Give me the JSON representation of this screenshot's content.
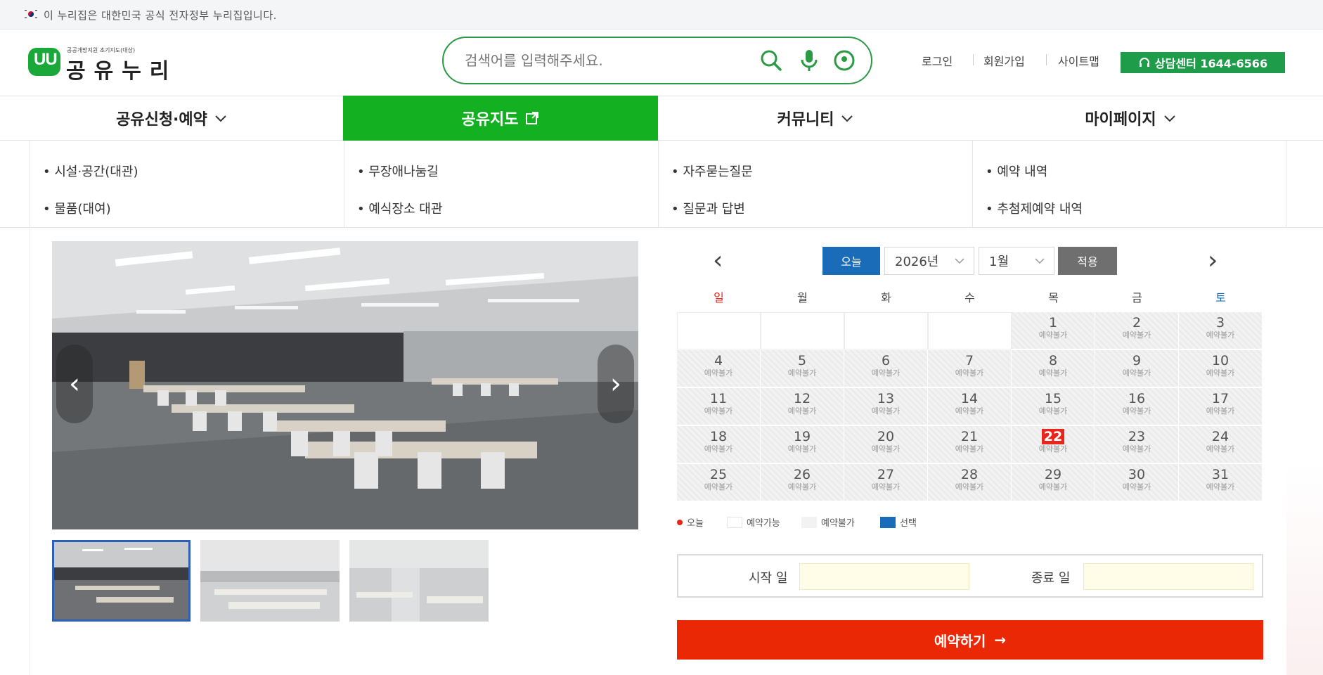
{
  "gov_banner": {
    "text": "이 누리집은 대한민국 공식 전자정부 누리집입니다."
  },
  "logo": {
    "subtitle": "공공개방지원 초기지도(대상)",
    "name": "공유누리"
  },
  "search": {
    "placeholder": "검색어를 입력해주세요.",
    "icons": [
      "search-icon",
      "microphone-icon",
      "location-icon"
    ]
  },
  "utility": {
    "login": "로그인",
    "signup": "회원가입",
    "sitemap": "사이트맵",
    "call_center": "상담센터 1644-6566"
  },
  "nav": {
    "items": [
      {
        "label": "공유신청·예약",
        "icon": "chevron-down-icon",
        "active": false
      },
      {
        "label": "공유지도",
        "icon": "external-link-icon",
        "active": true
      },
      {
        "label": "커뮤니티",
        "icon": "chevron-down-icon",
        "active": false
      },
      {
        "label": "마이페이지",
        "icon": "chevron-down-icon",
        "active": false
      }
    ]
  },
  "submenu": {
    "columns": [
      [
        "• 시설·공간(대관)",
        "• 물품(대여)"
      ],
      [
        "• 무장애나눔길",
        "• 예식장소 대관"
      ],
      [
        "• 자주묻는질문",
        "• 질문과 답변"
      ],
      [
        "• 예약 내역",
        "• 추첨제예약 내역"
      ]
    ]
  },
  "gallery": {
    "main_image": "conference-room-photo",
    "prev_icon": "chevron-left-icon",
    "next_icon": "chevron-right-icon",
    "thumbnails": [
      {
        "name": "thumbnail-1",
        "selected": true
      },
      {
        "name": "thumbnail-2",
        "selected": false
      },
      {
        "name": "thumbnail-3",
        "selected": false
      }
    ]
  },
  "calendar": {
    "today_label": "오늘",
    "year": "2026년",
    "month": "1월",
    "apply_label": "적용",
    "weekdays": [
      "일",
      "월",
      "화",
      "수",
      "목",
      "금",
      "토"
    ],
    "first_weekday_index": 4,
    "days_in_month": 31,
    "today": 22,
    "day_status": "예약불가",
    "colors": {
      "sunday": "#e8261b",
      "saturday": "#1a6cb8",
      "today": "#e8261b",
      "selected": "#1a6cb8"
    }
  },
  "legend": {
    "today": "오늘",
    "available": "예약가능",
    "unavailable": "예약불가",
    "selected": "선택"
  },
  "reservation": {
    "start_label": "시작 일",
    "start_value": "",
    "end_label": "종료 일",
    "end_value": "",
    "submit_label": "예약하기"
  },
  "colors": {
    "brand_green": "#1f9c4a",
    "nav_active": "#13b021",
    "submit": "#eb2805",
    "accent_blue": "#1a6cb8"
  }
}
